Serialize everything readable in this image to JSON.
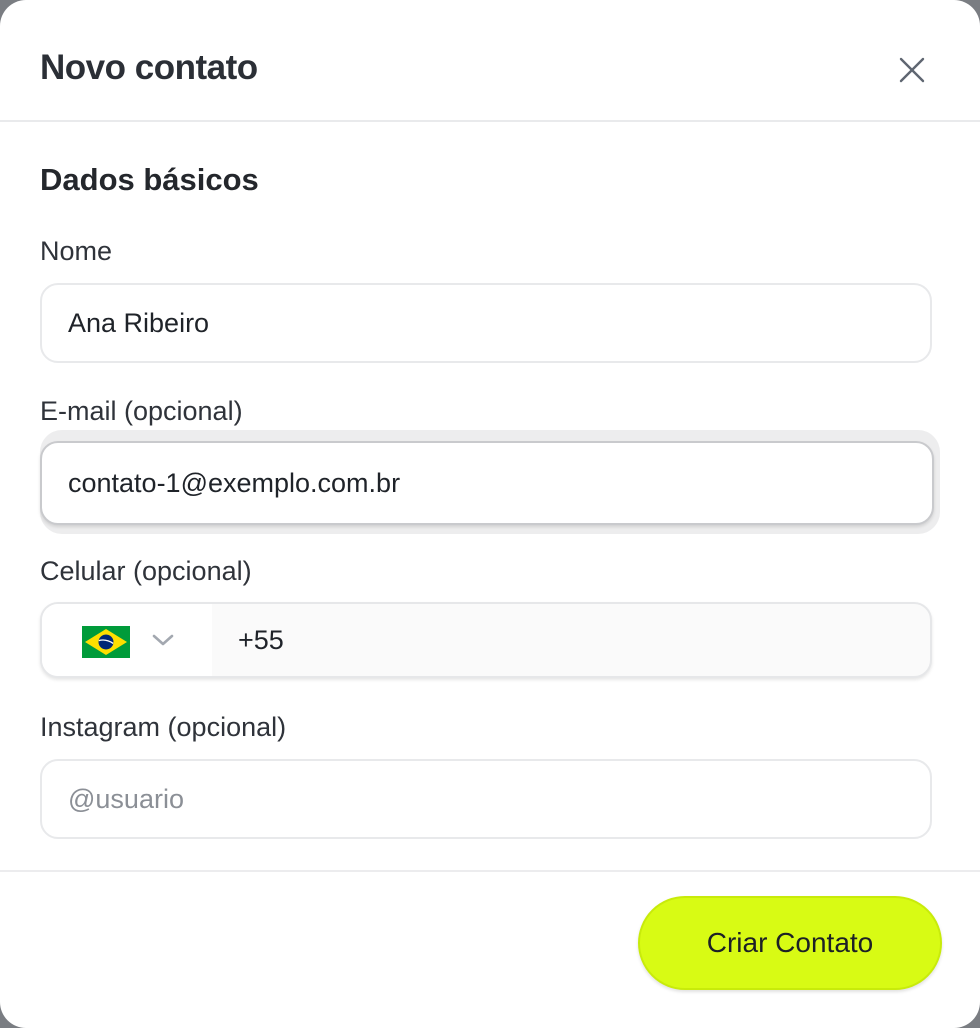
{
  "dialog": {
    "title": "Novo contato",
    "close_icon": "close-icon"
  },
  "section": {
    "title": "Dados básicos"
  },
  "fields": {
    "name": {
      "label": "Nome",
      "value": "Ana Ribeiro",
      "placeholder": ""
    },
    "email": {
      "label": "E-mail (opcional)",
      "value": "contato-1@exemplo.com.br",
      "placeholder": ""
    },
    "phone": {
      "label": "Celular (opcional)",
      "country_flag": "brazil-flag-icon",
      "country_chevron": "chevron-down-icon",
      "value": "+55"
    },
    "instagram": {
      "label": "Instagram (opcional)",
      "value": "",
      "placeholder": "@usuario"
    }
  },
  "actions": {
    "submit_label": "Criar Contato"
  },
  "colors": {
    "primary_button": "#d8fb14",
    "flag_green": "#009b3a",
    "flag_yellow": "#fedf00",
    "flag_blue": "#002776"
  }
}
